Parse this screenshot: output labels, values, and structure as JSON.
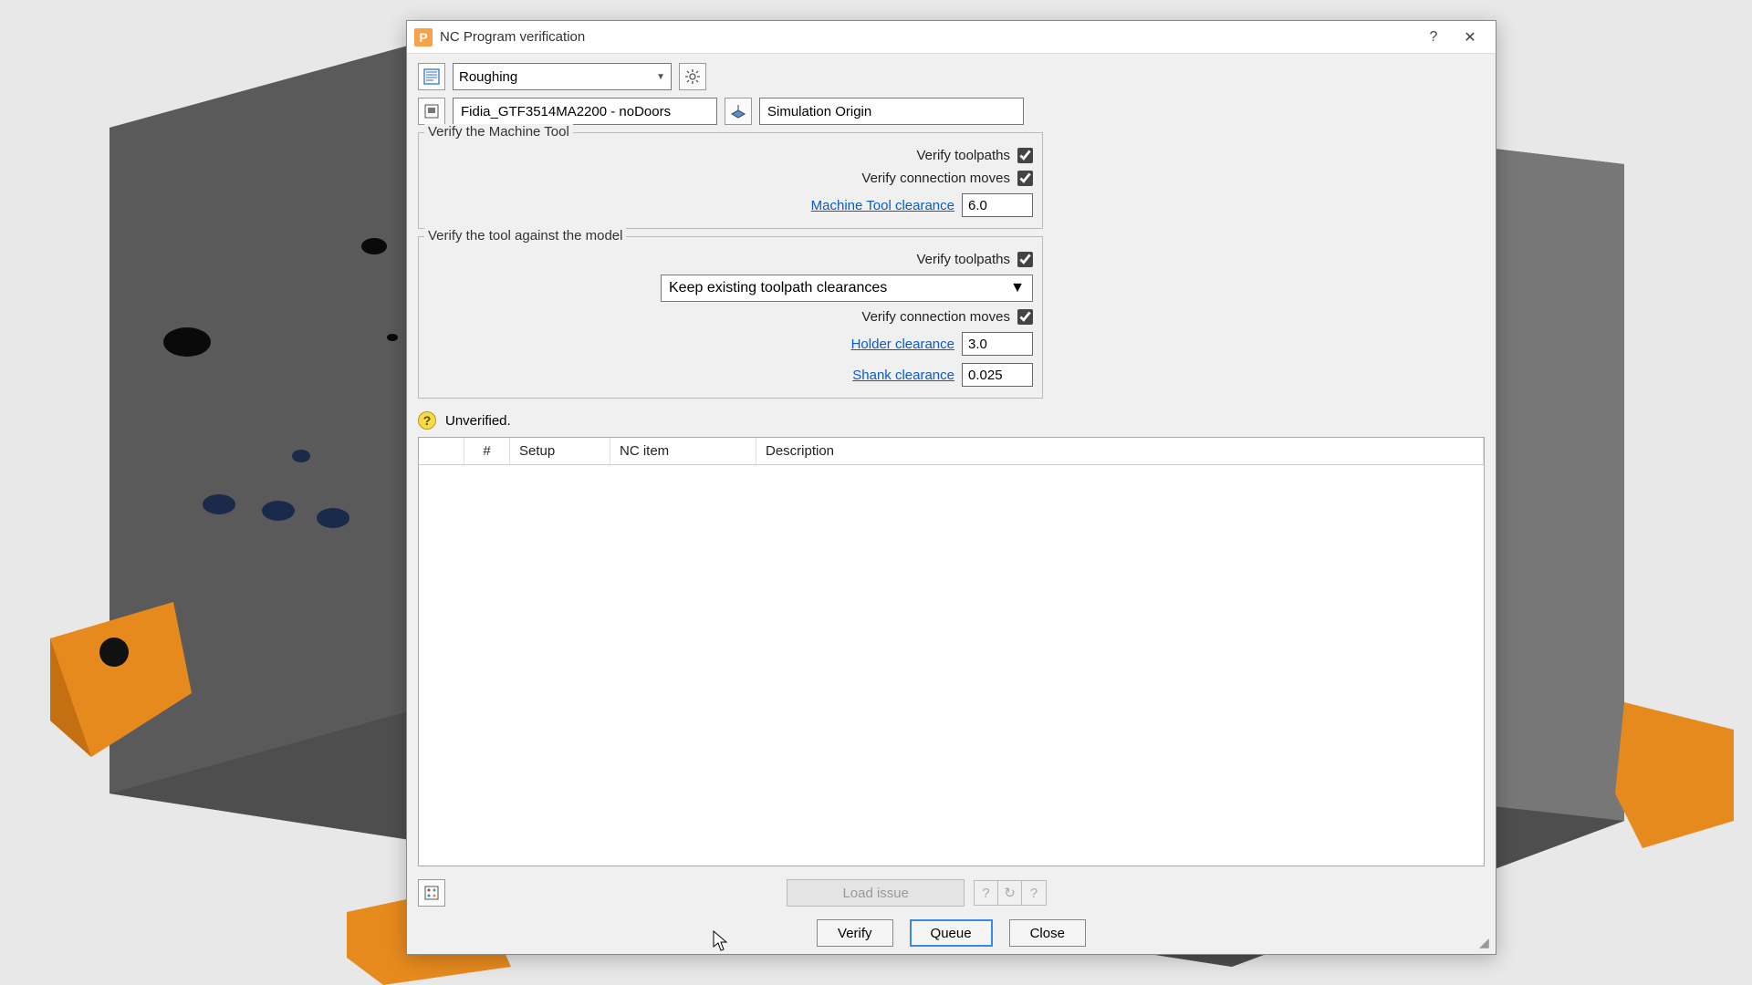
{
  "window": {
    "title": "NC Program verification",
    "app_icon_letter": "P",
    "help_glyph": "?",
    "close_glyph": "✕"
  },
  "top": {
    "operation_dropdown": "Roughing"
  },
  "machine": {
    "name": "Fidia_GTF3514MA2200 - noDoors",
    "workplane": "Simulation Origin"
  },
  "group_machine_tool": {
    "legend": "Verify the Machine Tool",
    "verify_toolpaths_label": "Verify toolpaths",
    "verify_toolpaths_checked": true,
    "verify_connection_label": "Verify connection moves",
    "verify_connection_checked": true,
    "clearance_label": "Machine Tool clearance",
    "clearance_value": "6.0"
  },
  "group_model": {
    "legend": "Verify the tool against the model",
    "verify_toolpaths_label": "Verify toolpaths",
    "verify_toolpaths_checked": true,
    "clearance_mode": "Keep existing toolpath clearances",
    "verify_connection_label": "Verify connection moves",
    "verify_connection_checked": true,
    "holder_label": "Holder clearance",
    "holder_value": "3.0",
    "shank_label": "Shank clearance",
    "shank_value": "0.025"
  },
  "status": {
    "text": "Unverified."
  },
  "table": {
    "headers": [
      "",
      "#",
      "Setup",
      "NC item",
      "Description"
    ]
  },
  "buttons": {
    "load_issue": "Load issue",
    "verify": "Verify",
    "queue": "Queue",
    "close": "Close"
  }
}
